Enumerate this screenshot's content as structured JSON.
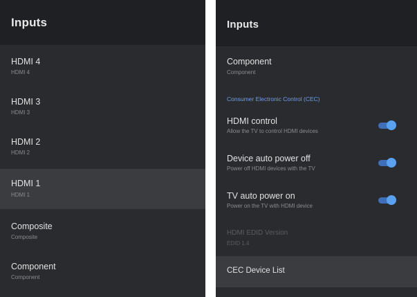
{
  "left_panel": {
    "title": "Inputs",
    "items": [
      {
        "label": "HDMI 4",
        "sub": "HDMI 4"
      },
      {
        "label": "HDMI 3",
        "sub": "HDMI 3"
      },
      {
        "label": "HDMI 2",
        "sub": "HDMI 2"
      },
      {
        "label": "HDMI 1",
        "sub": "HDMI 1"
      },
      {
        "label": "Composite",
        "sub": "Composite"
      },
      {
        "label": "Component",
        "sub": "Component"
      }
    ]
  },
  "right_panel": {
    "title": "Inputs",
    "component": {
      "label": "Component",
      "sub": "Component"
    },
    "cec_section_header": "Consumer Electronic Control (CEC)",
    "hdmi_control": {
      "label": "HDMI control",
      "sub": "Allow the TV to control HDMI devices",
      "enabled": true
    },
    "device_auto_power_off": {
      "label": "Device auto power off",
      "sub": "Power off HDMI devices with the TV",
      "enabled": true
    },
    "tv_auto_power_on": {
      "label": "TV auto power on",
      "sub": "Power on the TV with HDMI device",
      "enabled": true
    },
    "hdmi_edid_version": {
      "label": "HDMI EDID Version",
      "sub": "EDID 1.4"
    },
    "cec_device_list": {
      "label": "CEC Device List"
    }
  },
  "colors": {
    "panel_background": "#2a2b2e",
    "header_background": "#1f2023",
    "focused_row": "#3b3c3f",
    "accent": "#5aa2ef",
    "section_header": "#6f9fe8"
  }
}
